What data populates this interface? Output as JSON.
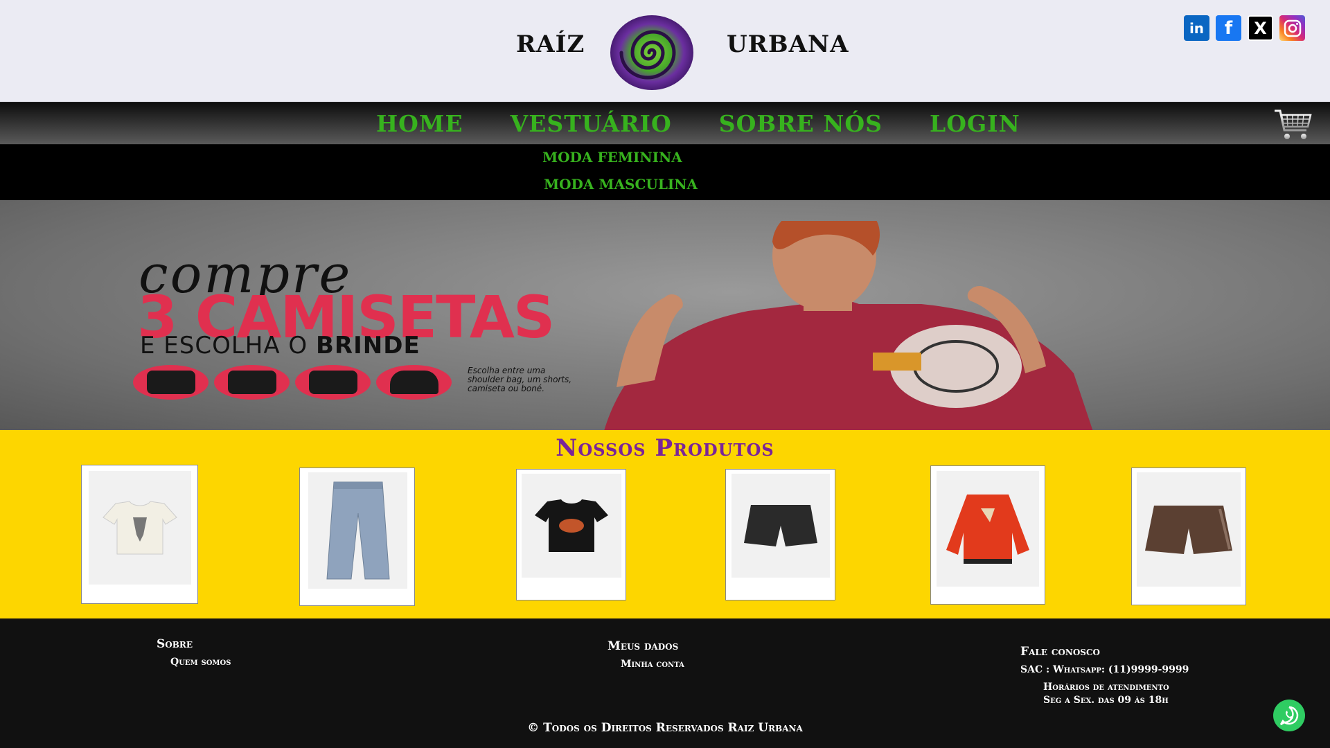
{
  "header": {
    "brand_left": "RAÍZ",
    "brand_right": "URBANA",
    "social": [
      {
        "name": "linkedin-icon",
        "glyph": "in"
      },
      {
        "name": "facebook-icon",
        "glyph": "f"
      },
      {
        "name": "x-icon",
        "glyph": "X"
      },
      {
        "name": "instagram-icon",
        "glyph": ""
      }
    ]
  },
  "nav": {
    "items": [
      "HOME",
      "VESTUÁRIO",
      "SOBRE NÓS",
      "LOGIN"
    ],
    "dropdown": [
      "MODA FEMININA",
      "MODA MASCULINA"
    ]
  },
  "hero": {
    "compre": "compre",
    "big": "3 CAMISETAS",
    "sub_prefix": "E ESCOLHA O",
    "sub_bold": "BRINDE",
    "note": "Escolha entre uma shoulder bag, um shorts, camiseta ou boné."
  },
  "products": {
    "title": "Nossos Produtos",
    "items": [
      {
        "name": "white-graphic-tee",
        "color": "#f2efe4"
      },
      {
        "name": "baggy-jeans",
        "color": "#8fa3bd"
      },
      {
        "name": "black-graphic-tee",
        "color": "#151515"
      },
      {
        "name": "black-shorts",
        "color": "#2a2a2a"
      },
      {
        "name": "red-bomber-jacket",
        "color": "#e23a1c"
      },
      {
        "name": "brown-shorts",
        "color": "#5b4032"
      }
    ]
  },
  "footer": {
    "sobre": "Sobre",
    "quem_somos": "Quem somos",
    "meus_dados": "Meus dados",
    "minha_conta": "Minha conta",
    "fale_conosco": "Fale conosco",
    "sac": "SAC : Whatsapp: (11)9999-9999",
    "horarios": "Horários de atendimento",
    "dias": "Seg a Sex. das 09 às 18h",
    "copyright": "© Todos os Direitos Reservados Raiz Urbana"
  },
  "colors": {
    "accent_green": "#37b21e",
    "products_bg": "#fdd600",
    "title_purple": "#7a2499",
    "hero_red": "#e0304f"
  }
}
